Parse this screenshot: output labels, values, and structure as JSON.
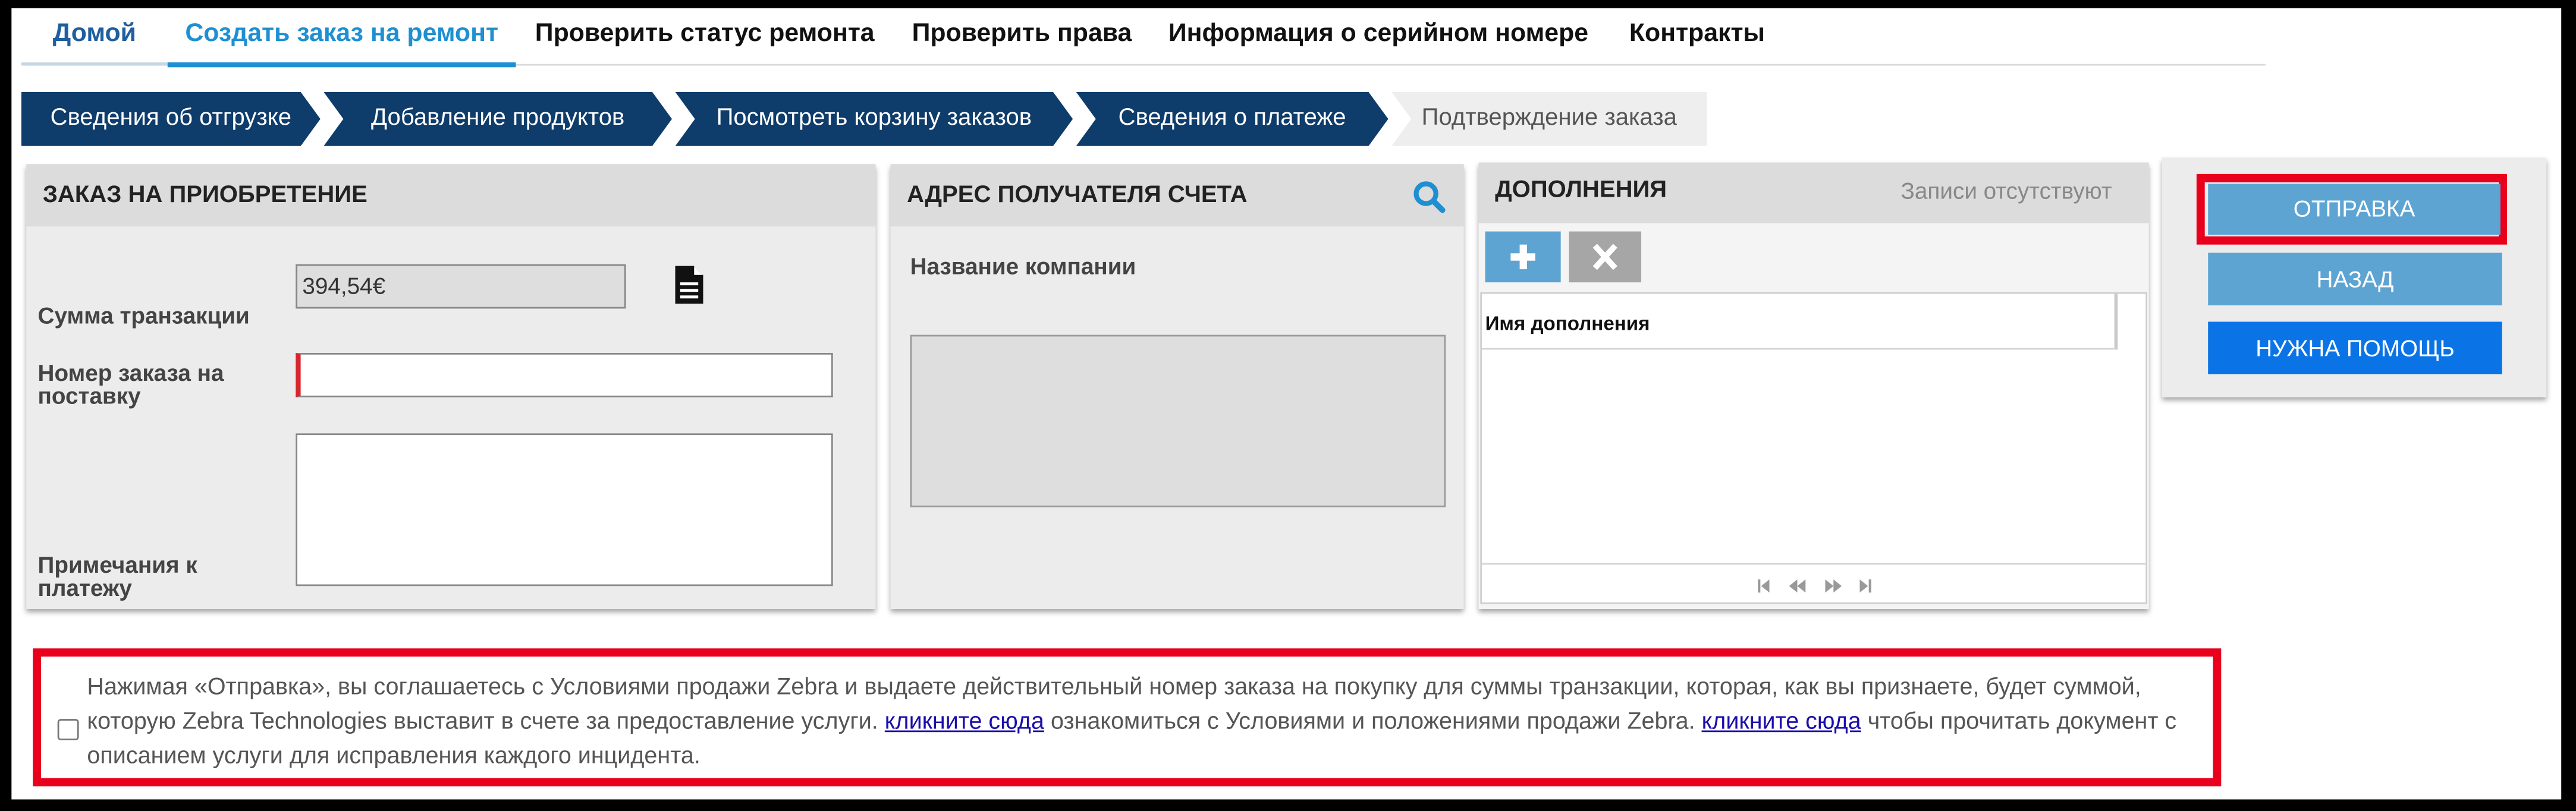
{
  "nav": {
    "items": [
      {
        "label": "Домой"
      },
      {
        "label": "Создать заказ на ремонт"
      },
      {
        "label": "Проверить статус ремонта"
      },
      {
        "label": "Проверить права"
      },
      {
        "label": "Информация о серийном номере"
      },
      {
        "label": "Контракты"
      }
    ],
    "active_index": 1
  },
  "steps": [
    {
      "label": "Сведения об отгрузке"
    },
    {
      "label": "Добавление продуктов"
    },
    {
      "label": "Посмотреть корзину заказов"
    },
    {
      "label": "Сведения о платеже"
    },
    {
      "label": "Подтверждение заказа"
    }
  ],
  "purchase": {
    "title": "ЗАКАЗ НА ПРИОБРЕТЕНИЕ",
    "amount_label": "Сумма транзакции",
    "amount_value": "394,54€",
    "po_label_line1": "Номер заказа на",
    "po_label_line2": "поставку",
    "po_value": "",
    "notes_label_line1": "Примечания к",
    "notes_label_line2": "платежу",
    "notes_value": ""
  },
  "billing": {
    "title": "АДРЕС ПОЛУЧАТЕЛЯ СЧЕТА",
    "company_label": "Название компании",
    "address_value": ""
  },
  "addons": {
    "title": "ДОПОЛНЕНИЯ",
    "empty_text": "Записи отсутствуют",
    "column_name": "Имя дополнения"
  },
  "actions": {
    "submit_label": "ОТПРАВКА",
    "back_label": "НАЗАД",
    "help_label": "НУЖНА ПОМОЩЬ"
  },
  "terms": {
    "text_1": "Нажимая «Отправка», вы соглашаетесь с Условиями продажи Zebra и выдаете действительный номер заказа на покупку для суммы транзакции, которая, как вы признаете, будет суммой, которую Zebra Technologies выставит в счете за предоставление услуги.",
    "link_1": "кликните сюда",
    "text_2": "ознакомиться с Условиями и положениями продажи Zebra.",
    "link_2": "кликните сюда",
    "text_3": "чтобы прочитать документ с описанием услуги для исправления каждого инцидента.",
    "checked": false
  },
  "colors": {
    "brand_navy": "#0e3c6b",
    "accent_blue": "#1f8fd1",
    "button_blue": "#5da4d3",
    "help_blue": "#0a74e6",
    "highlight_red": "#e8001c"
  }
}
